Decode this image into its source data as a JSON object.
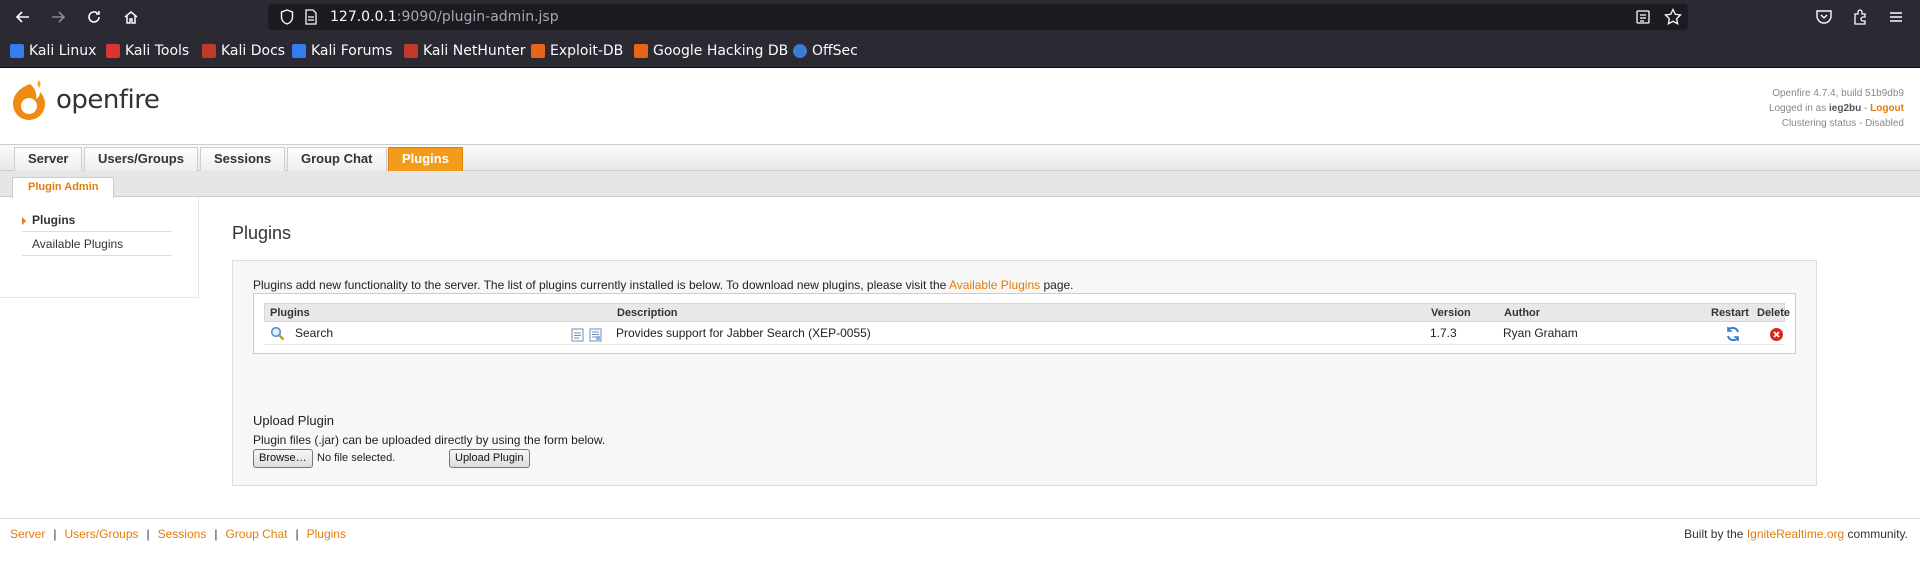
{
  "browser": {
    "url_host": "127.0.0.1",
    "url_rest": ":9090/plugin-admin.jsp",
    "bookmarks": [
      {
        "label": "Kali Linux",
        "color": "#367bf0"
      },
      {
        "label": "Kali Tools",
        "color": "#d33"
      },
      {
        "label": "Kali Docs",
        "color": "#c0392b"
      },
      {
        "label": "Kali Forums",
        "color": "#367bf0"
      },
      {
        "label": "Kali NetHunter",
        "color": "#c0392b"
      },
      {
        "label": "Exploit-DB",
        "color": "#e8641b"
      },
      {
        "label": "Google Hacking DB",
        "color": "#e8641b"
      },
      {
        "label": "OffSec",
        "color": "#3a7bd5"
      }
    ]
  },
  "header": {
    "logo_text": "openfire",
    "version_line": "Openfire 4.7.4, build 51b9db9",
    "logged_in_prefix": "Logged in as ",
    "username": "ieg2bu",
    "separator": " - ",
    "logout": "Logout",
    "clustering": "Clustering status - Disabled"
  },
  "main_tabs": [
    {
      "label": "Server",
      "active": false
    },
    {
      "label": "Users/Groups",
      "active": false
    },
    {
      "label": "Sessions",
      "active": false
    },
    {
      "label": "Group Chat",
      "active": false
    },
    {
      "label": "Plugins",
      "active": true
    }
  ],
  "sub_tab": "Plugin Admin",
  "sidebar": {
    "items": [
      {
        "label": "Plugins",
        "active": true
      },
      {
        "label": "Available Plugins",
        "active": false
      }
    ]
  },
  "page": {
    "title": "Plugins",
    "intro_before": "Plugins add new functionality to the server. The list of plugins currently installed is below. To download new plugins, please visit the ",
    "intro_link": "Available Plugins",
    "intro_after": " page.",
    "table": {
      "headers": [
        "Plugins",
        "Description",
        "Version",
        "Author",
        "Restart",
        "Delete"
      ],
      "rows": [
        {
          "name": "Search",
          "description": "Provides support for Jabber Search (XEP-0055)",
          "version": "1.7.3",
          "author": "Ryan Graham"
        }
      ]
    },
    "upload": {
      "title": "Upload Plugin",
      "description": "Plugin files (.jar) can be uploaded directly by using the form below.",
      "browse_label": "Browse…",
      "no_file": "No file selected.",
      "upload_label": "Upload Plugin"
    }
  },
  "footer": {
    "links": [
      "Server",
      "Users/Groups",
      "Sessions",
      "Group Chat",
      "Plugins"
    ],
    "built_by_prefix": "Built by the ",
    "built_by_link": "IgniteRealtime.org",
    "built_by_suffix": " community."
  },
  "colors": {
    "accent": "#e27d0a",
    "active_tab": "#f39c1c",
    "chrome_bg": "#2b2a33"
  }
}
